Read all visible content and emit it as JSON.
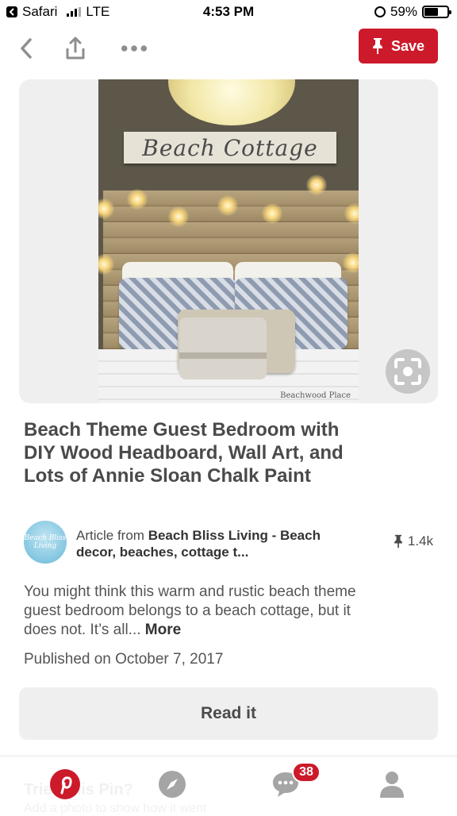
{
  "status_bar": {
    "back_app": "Safari",
    "network": "LTE",
    "time": "4:53 PM",
    "battery": "59%",
    "battery_level": 0.59
  },
  "nav": {
    "back_icon": "chevron-left-icon",
    "share_icon": "share-icon",
    "more_icon": "more-icon",
    "save_label": "Save",
    "save_color": "#cc1a2a"
  },
  "image": {
    "sign_text": "Beach Cottage",
    "watermark": "Beachwood Place",
    "zoom_icon": "visual-search-icon"
  },
  "pin": {
    "title": "Beach Theme Guest Bedroom with DIY Wood Headboard, Wall Art, and Lots of Annie Sloan Chalk Paint",
    "source_prefix": "Article from ",
    "source_name": "Beach Bliss Living - Beach decor, beaches, cottage t...",
    "avatar_text": "Beach Bliss Living",
    "save_count": "1.4k",
    "description": "You might think this warm and rustic beach theme guest bedroom belongs to a beach cottage, but it does not. It’s all... ",
    "more_label": "More",
    "published": "Published on October 7, 2017",
    "read_label": "Read it"
  },
  "tab_bar": {
    "ghost_title": "Tried this Pin?",
    "ghost_sub": "Add a photo to show how it went",
    "messages_badge": "38",
    "accent": "#cc1a2a"
  }
}
